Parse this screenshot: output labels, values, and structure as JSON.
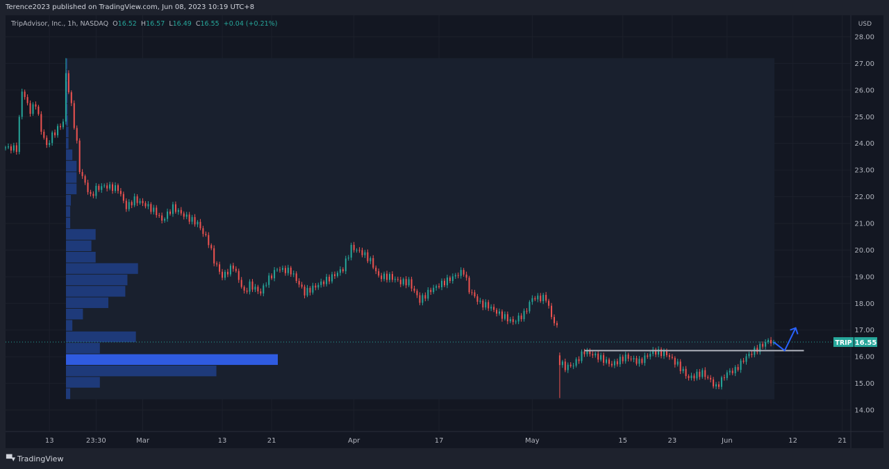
{
  "header": {
    "published": "Terence2023 published on TradingView.com, Jun 08, 2023 10:19 UTC+8"
  },
  "legend": {
    "symbol": "TripAdvisor, Inc., 1h, NASDAQ",
    "o_label": "O",
    "o": "16.52",
    "h_label": "H",
    "h": "16.57",
    "l_label": "L",
    "l": "16.49",
    "c_label": "C",
    "c": "16.55",
    "change": "+0.04 (+0.21%)"
  },
  "footer": {
    "brand": "TradingView",
    "logo_text": "TV"
  },
  "colors": {
    "up": "#26a69a",
    "down": "#ef5350",
    "profile": "#1e3a7a",
    "poc": "#2f5be0",
    "arrow": "#2962ff",
    "bg": "#131722",
    "value_area": "#19202e"
  },
  "chart_data": {
    "type": "candlestick",
    "currency": "USD",
    "ticker": "TRIP",
    "last_price": 16.55,
    "last_price_label": "16.55",
    "ylim": [
      14,
      28
    ],
    "y_ticks": [
      "28.00",
      "27.00",
      "26.00",
      "25.00",
      "24.00",
      "23.00",
      "22.00",
      "21.00",
      "20.00",
      "19.00",
      "18.00",
      "17.00",
      "16.00",
      "15.00",
      "14.00"
    ],
    "x_unit": "bar index (1h bars)",
    "xlim": [
      0,
      310
    ],
    "x_ticks": [
      {
        "t": 16,
        "label": "13"
      },
      {
        "t": 33,
        "label": "23:30"
      },
      {
        "t": 50,
        "label": "Mar"
      },
      {
        "t": 79,
        "label": "13"
      },
      {
        "t": 97,
        "label": "21"
      },
      {
        "t": 127,
        "label": "Apr"
      },
      {
        "t": 158,
        "label": "17"
      },
      {
        "t": 192,
        "label": "May"
      },
      {
        "t": 225,
        "label": "15"
      },
      {
        "t": 243,
        "label": "23"
      },
      {
        "t": 263,
        "label": "Jun"
      },
      {
        "t": 287,
        "label": "12"
      },
      {
        "t": 305,
        "label": "21"
      }
    ],
    "close_waypoints": [
      [
        0,
        23.85
      ],
      [
        4,
        23.8
      ],
      [
        6,
        26.0
      ],
      [
        9,
        25.2
      ],
      [
        11,
        25.5
      ],
      [
        13,
        24.5
      ],
      [
        15,
        23.9
      ],
      [
        17,
        24.3
      ],
      [
        21,
        24.8
      ],
      [
        22,
        26.6
      ],
      [
        24,
        25.4
      ],
      [
        26,
        24.0
      ],
      [
        27,
        23.0
      ],
      [
        29,
        22.5
      ],
      [
        31,
        22.0
      ],
      [
        33,
        22.3
      ],
      [
        36,
        22.4
      ],
      [
        41,
        22.3
      ],
      [
        44,
        21.6
      ],
      [
        47,
        21.9
      ],
      [
        51,
        21.7
      ],
      [
        55,
        21.4
      ],
      [
        57,
        21.1
      ],
      [
        61,
        21.6
      ],
      [
        65,
        21.3
      ],
      [
        70,
        21.0
      ],
      [
        74,
        20.3
      ],
      [
        76,
        19.6
      ],
      [
        79,
        19.0
      ],
      [
        83,
        19.4
      ],
      [
        87,
        18.4
      ],
      [
        89,
        18.7
      ],
      [
        93,
        18.4
      ],
      [
        95,
        18.8
      ],
      [
        99,
        19.3
      ],
      [
        104,
        19.2
      ],
      [
        109,
        18.4
      ],
      [
        114,
        18.7
      ],
      [
        119,
        19.0
      ],
      [
        123,
        19.3
      ],
      [
        126,
        20.1
      ],
      [
        130,
        19.9
      ],
      [
        133,
        19.6
      ],
      [
        136,
        19.0
      ],
      [
        140,
        19.0
      ],
      [
        144,
        18.8
      ],
      [
        147,
        18.8
      ],
      [
        151,
        18.1
      ],
      [
        155,
        18.5
      ],
      [
        160,
        18.8
      ],
      [
        165,
        19.1
      ],
      [
        167,
        19.2
      ],
      [
        169,
        18.5
      ],
      [
        173,
        18.0
      ],
      [
        176,
        17.9
      ],
      [
        180,
        17.6
      ],
      [
        185,
        17.3
      ],
      [
        189,
        17.6
      ],
      [
        192,
        18.2
      ],
      [
        197,
        18.2
      ],
      [
        199,
        17.5
      ],
      [
        201,
        17.1
      ],
      [
        202,
        15.8
      ],
      [
        204,
        15.6
      ],
      [
        207,
        15.7
      ],
      [
        211,
        16.2
      ],
      [
        216,
        16.0
      ],
      [
        221,
        15.7
      ],
      [
        226,
        16.0
      ],
      [
        231,
        15.8
      ],
      [
        236,
        16.2
      ],
      [
        241,
        16.1
      ],
      [
        245,
        15.7
      ],
      [
        249,
        15.2
      ],
      [
        254,
        15.4
      ],
      [
        257,
        15.1
      ],
      [
        259,
        14.85
      ],
      [
        263,
        15.4
      ],
      [
        266,
        15.5
      ],
      [
        270,
        16.0
      ],
      [
        274,
        16.3
      ],
      [
        278,
        16.6
      ],
      [
        280,
        16.55
      ]
    ],
    "spike_high": {
      "t": 22,
      "price": 27.2
    },
    "gap_low": {
      "t": 202,
      "price": 14.45
    },
    "volume_profile": {
      "price_range": [
        14.4,
        27.2
      ],
      "rows_bottom_to_top": [
        0.02,
        0.16,
        0.71,
        1.0,
        0.16,
        0.33,
        0.03,
        0.08,
        0.2,
        0.28,
        0.29,
        0.34,
        0.14,
        0.12,
        0.14,
        0.02,
        0.02,
        0.023,
        0.05,
        0.05,
        0.05,
        0.03,
        0.012,
        0.012,
        0.01,
        0.008,
        0.008,
        0.006,
        0.006,
        0.006
      ],
      "poc_row": 3
    },
    "annotations": [
      {
        "type": "horizontal_line",
        "price": 16.23,
        "from_t": 211,
        "to_t": 291,
        "color": "#b2b5be"
      },
      {
        "type": "arrow_path",
        "points": [
          [
            280,
            16.55
          ],
          [
            284,
            16.23
          ],
          [
            288,
            17.08
          ]
        ],
        "color": "#2962ff"
      }
    ]
  }
}
